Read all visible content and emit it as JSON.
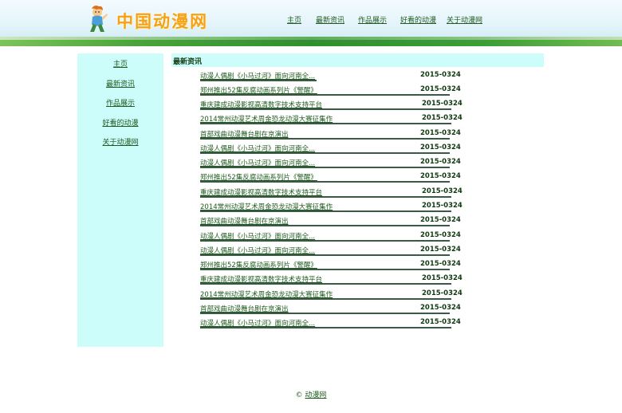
{
  "site": {
    "logo_text": "中国动漫网"
  },
  "topnav": [
    {
      "label": "主页"
    },
    {
      "label": "最新资讯"
    },
    {
      "label": "作品展示"
    },
    {
      "label": "好看的动漫"
    },
    {
      "label": "关于动漫网"
    }
  ],
  "sidebar": {
    "items": [
      {
        "label": "主页"
      },
      {
        "label": "最新资讯"
      },
      {
        "label": "作品展示"
      },
      {
        "label": "好看的动漫"
      },
      {
        "label": "关于动漫网"
      }
    ]
  },
  "main": {
    "title": "最新资讯",
    "news": [
      {
        "title": "动漫人偶剧《小马过河》面向河南全...",
        "date": "2015-0324"
      },
      {
        "title": "郑州推出52集反腐动画系列片《警醒》",
        "date": "2015-0324"
      },
      {
        "title": "重庆建成动漫影视高清数字技术支持平台",
        "date": "2015-0324"
      },
      {
        "title": "2014常州动漫艺术周金恐龙动漫大赛征集作",
        "date": "2015-0324"
      },
      {
        "title": "首部戏曲动漫舞台剧在京演出",
        "date": "2015-0324"
      },
      {
        "title": "动漫人偶剧《小马过河》面向河南全...",
        "date": "2015-0324"
      },
      {
        "title": "动漫人偶剧《小马过河》面向河南全...",
        "date": "2015-0324"
      },
      {
        "title": "郑州推出52集反腐动画系列片《警醒》",
        "date": "2015-0324"
      },
      {
        "title": "重庆建成动漫影视高清数字技术支持平台",
        "date": "2015-0324"
      },
      {
        "title": "2014常州动漫艺术周金恐龙动漫大赛征集作",
        "date": "2015-0324"
      },
      {
        "title": "首部戏曲动漫舞台剧在京演出",
        "date": "2015-0324"
      },
      {
        "title": "动漫人偶剧《小马过河》面向河南全...",
        "date": "2015-0324"
      },
      {
        "title": "动漫人偶剧《小马过河》面向河南全...",
        "date": "2015-0324"
      },
      {
        "title": "郑州推出52集反腐动画系列片《警醒》",
        "date": "2015-0324"
      },
      {
        "title": "重庆建成动漫影视高清数字技术支持平台",
        "date": "2015-0324"
      },
      {
        "title": "2014常州动漫艺术周金恐龙动漫大赛征集作",
        "date": "2015-0324"
      },
      {
        "title": "首部戏曲动漫舞台剧在京演出",
        "date": "2015-0324"
      },
      {
        "title": "动漫人偶剧《小马过河》面向河南全...",
        "date": "2015-0324"
      }
    ]
  },
  "footer": {
    "copyright_symbol": "©",
    "link_label": "动漫网"
  },
  "colors": {
    "panel": "#ccfdfb",
    "link": "#1e5a1e",
    "logo": "#f3a21a",
    "band": "#2f8f2f"
  }
}
